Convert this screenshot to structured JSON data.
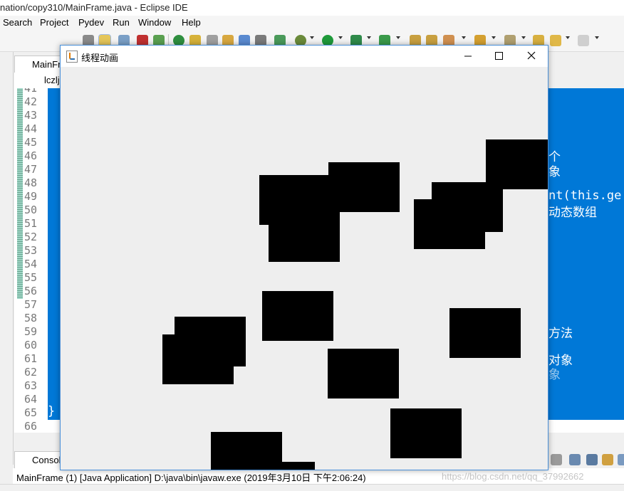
{
  "eclipse": {
    "title": "nation/copy310/MainFrame.java - Eclipse IDE",
    "menu": [
      "Search",
      "Project",
      "Pydev",
      "Run",
      "Window",
      "Help"
    ],
    "editor_tab": "MainFr",
    "breadcrumb": "lczlj",
    "line_numbers": [
      "41",
      "42",
      "43",
      "44",
      "45",
      "46",
      "47",
      "48",
      "49",
      "50",
      "51",
      "52",
      "53",
      "54",
      "55",
      "56",
      "57",
      "58",
      "59",
      "60",
      "61",
      "62",
      "63",
      "64",
      "65",
      "66"
    ],
    "code_fragments": {
      "a": "个",
      "b": "象",
      "c": "nt(this.ge",
      "d": "动态数组",
      "e": "方法",
      "f": "对象",
      "g": "象",
      "h": "}"
    },
    "console_tab": "Consol",
    "status": "MainFrame (1) [Java Application] D:\\java\\bin\\javaw.exe (2019年3月10日 下午2:06:24)",
    "watermark": "https://blog.csdn.net/qq_37992662"
  },
  "swing": {
    "title": "线程动画",
    "minimize": "—",
    "maximize": "☐",
    "close": "✕",
    "canvas_bg": "#eeeeee",
    "rect_color": "#000000",
    "rect_count": 14
  },
  "colors": {
    "selection": "#0078d7",
    "gutter_text": "#787878",
    "window_border": "#4a90d9"
  }
}
